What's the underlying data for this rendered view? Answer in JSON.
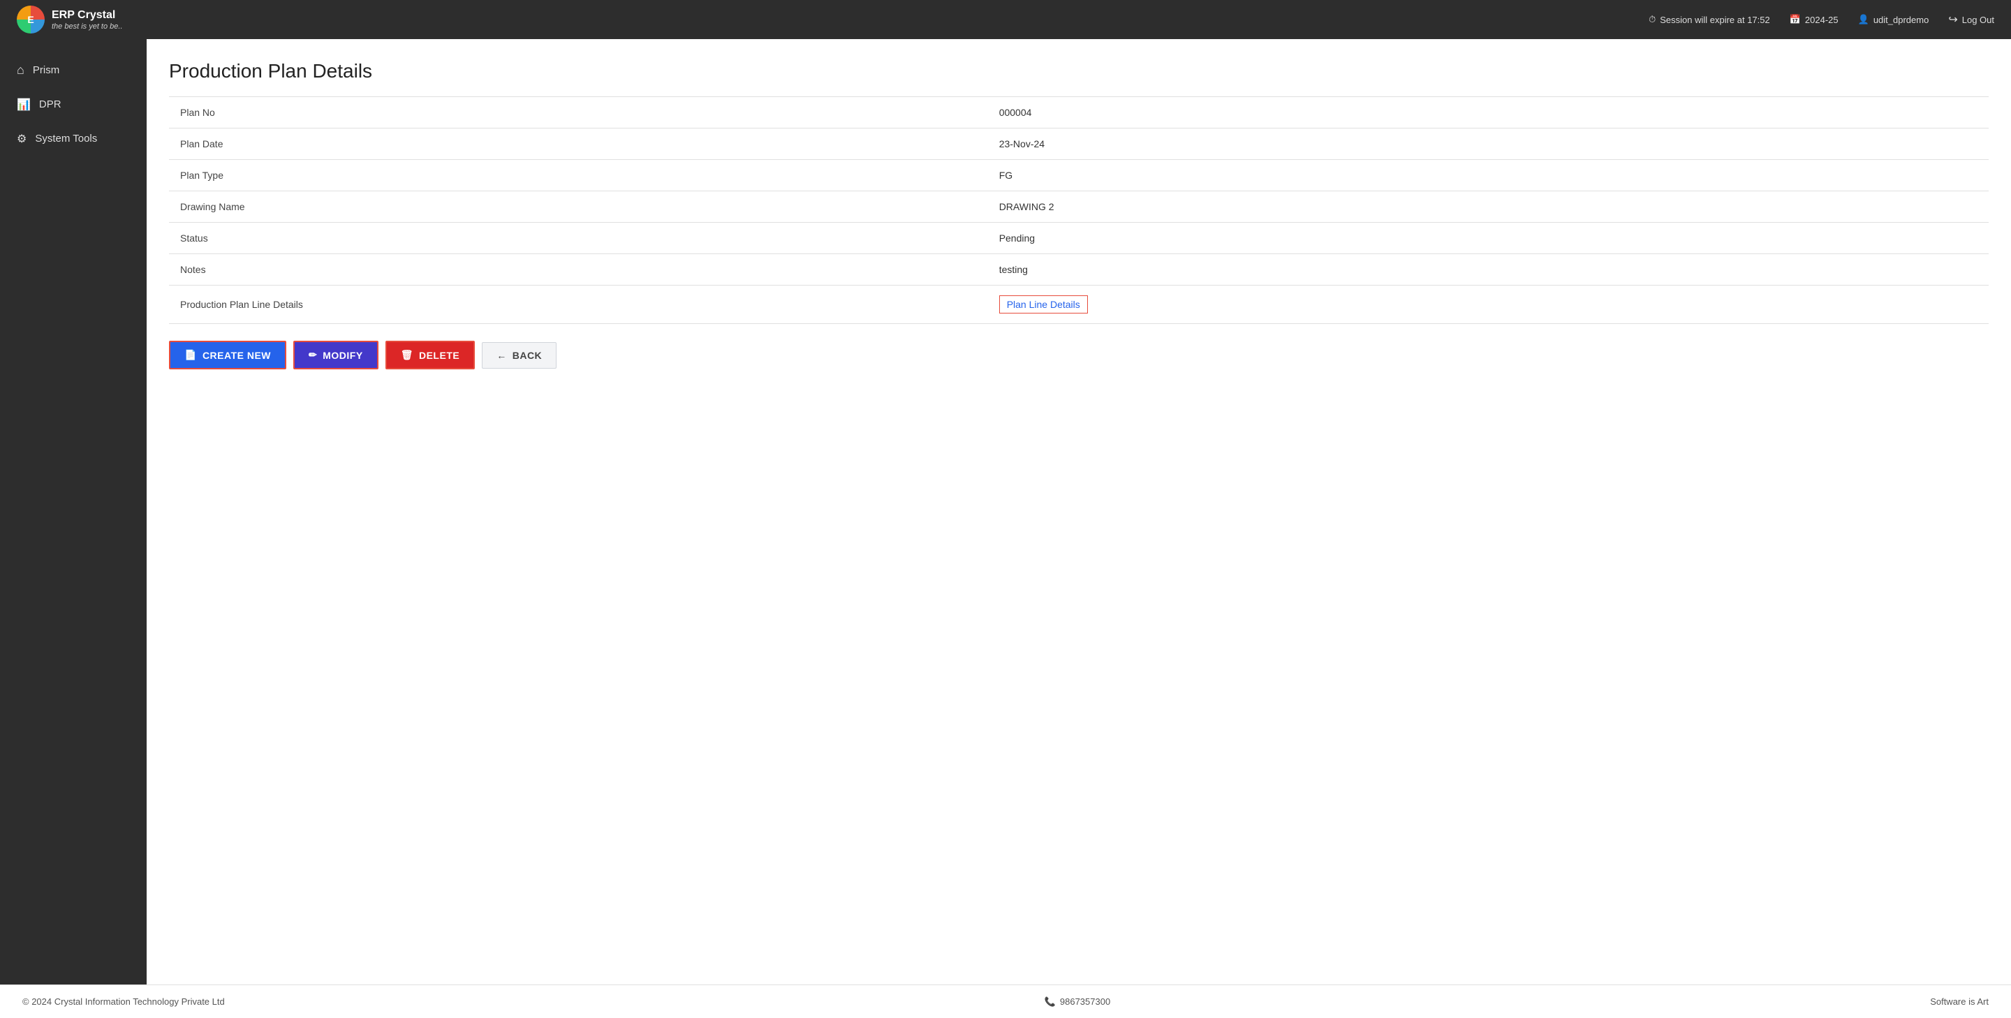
{
  "header": {
    "logo_title": "ERP Crystal",
    "logo_subtitle": "the best is yet to be..",
    "session_label": "Session will expire at 17:52",
    "year_label": "2024-25",
    "user_label": "udit_dprdemo",
    "logout_label": "Log Out"
  },
  "sidebar": {
    "items": [
      {
        "id": "prism",
        "label": "Prism",
        "icon": "home"
      },
      {
        "id": "dpr",
        "label": "DPR",
        "icon": "bar"
      },
      {
        "id": "system-tools",
        "label": "System Tools",
        "icon": "gear"
      }
    ]
  },
  "page": {
    "title": "Production Plan Details",
    "fields": [
      {
        "label": "Plan No",
        "value": "000004"
      },
      {
        "label": "Plan Date",
        "value": "23-Nov-24"
      },
      {
        "label": "Plan Type",
        "value": "FG"
      },
      {
        "label": "Drawing Name",
        "value": "DRAWING 2"
      },
      {
        "label": "Status",
        "value": "Pending"
      },
      {
        "label": "Notes",
        "value": "testing"
      },
      {
        "label": "Production Plan Line Details",
        "value": "Plan Line Details",
        "is_link": true
      }
    ],
    "buttons": {
      "create_new": "CREATE NEW",
      "modify": "MODIFY",
      "delete": "DELETE",
      "back": "BACK"
    }
  },
  "footer": {
    "copyright": "© 2024 Crystal Information Technology Private Ltd",
    "phone": "9867357300",
    "tagline": "Software is Art"
  }
}
